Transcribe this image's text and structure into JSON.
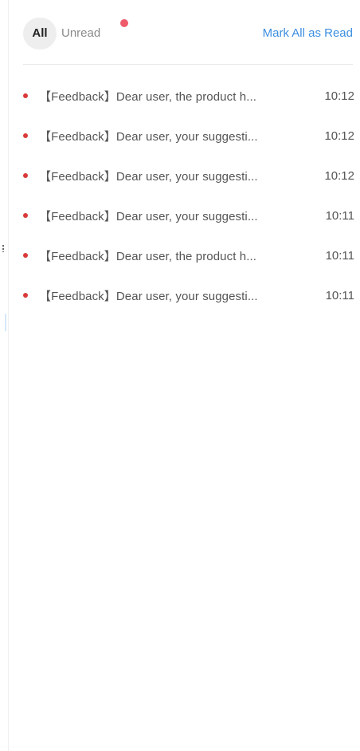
{
  "tabs": {
    "all_label": "All",
    "unread_label": "Unread",
    "unread_has_indicator": true
  },
  "actions": {
    "mark_all_read_label": "Mark All as Read"
  },
  "colors": {
    "accent": "#3d8fe0",
    "unread_dot": "#d93a3a",
    "badge": "#ee5b6b"
  },
  "notifications": [
    {
      "text": "【Feedback】Dear user, the product h...",
      "time": "10:12",
      "unread": true
    },
    {
      "text": "【Feedback】Dear user, your suggesti...",
      "time": "10:12",
      "unread": true
    },
    {
      "text": "【Feedback】Dear user, your suggesti...",
      "time": "10:12",
      "unread": true
    },
    {
      "text": "【Feedback】Dear user, your suggesti...",
      "time": "10:11",
      "unread": true
    },
    {
      "text": "【Feedback】Dear user, the product h...",
      "time": "10:11",
      "unread": true
    },
    {
      "text": "【Feedback】Dear user, your suggesti...",
      "time": "10:11",
      "unread": true
    }
  ]
}
